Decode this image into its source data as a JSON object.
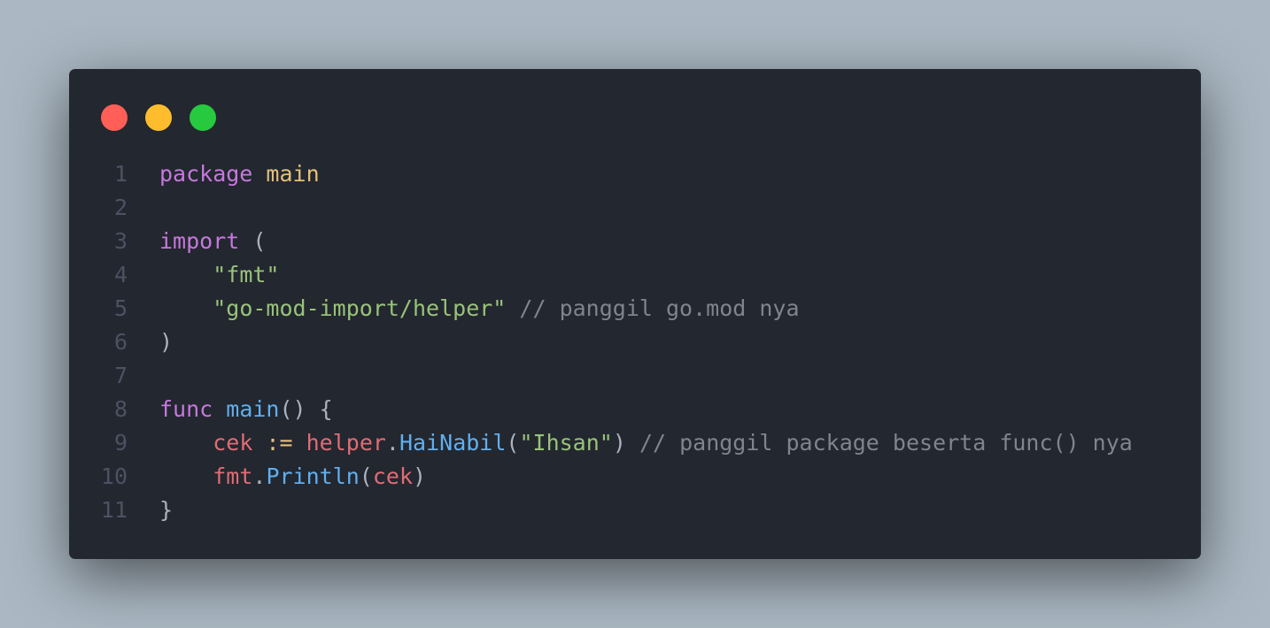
{
  "window": {
    "background": "#23272f",
    "page_background": "#abb8c3",
    "controls": [
      {
        "name": "close-dot",
        "color": "#ff5f56"
      },
      {
        "name": "minimize-dot",
        "color": "#ffbd2e"
      },
      {
        "name": "maximize-dot",
        "color": "#27c93f"
      }
    ]
  },
  "colors": {
    "keyword": "#c678dd",
    "type": "#e5c07b",
    "string": "#98c379",
    "comment": "#7f848e",
    "function": "#61afef",
    "variable": "#e06c75",
    "operator": "#56b6c2",
    "plain": "#abb2bf",
    "line_number": "#4b5263"
  },
  "code": {
    "language": "go",
    "lines": [
      {
        "number": "1",
        "tokens": [
          {
            "text": "package",
            "type": "keyword"
          },
          {
            "text": " ",
            "type": "plain"
          },
          {
            "text": "main",
            "type": "type"
          }
        ]
      },
      {
        "number": "2",
        "tokens": []
      },
      {
        "number": "3",
        "tokens": [
          {
            "text": "import",
            "type": "keyword"
          },
          {
            "text": " (",
            "type": "plain"
          }
        ]
      },
      {
        "number": "4",
        "tokens": [
          {
            "text": "    ",
            "type": "plain"
          },
          {
            "text": "\"fmt\"",
            "type": "string"
          }
        ]
      },
      {
        "number": "5",
        "tokens": [
          {
            "text": "    ",
            "type": "plain"
          },
          {
            "text": "\"go-mod-import/helper\"",
            "type": "string"
          },
          {
            "text": " ",
            "type": "plain"
          },
          {
            "text": "// panggil go.mod nya",
            "type": "comment"
          }
        ]
      },
      {
        "number": "6",
        "tokens": [
          {
            "text": ")",
            "type": "plain"
          }
        ]
      },
      {
        "number": "7",
        "tokens": []
      },
      {
        "number": "8",
        "tokens": [
          {
            "text": "func",
            "type": "keyword"
          },
          {
            "text": " ",
            "type": "plain"
          },
          {
            "text": "main",
            "type": "function"
          },
          {
            "text": "() {",
            "type": "plain"
          }
        ]
      },
      {
        "number": "9",
        "tokens": [
          {
            "text": "    ",
            "type": "plain"
          },
          {
            "text": "cek",
            "type": "variable"
          },
          {
            "text": " ",
            "type": "plain"
          },
          {
            "text": ":=",
            "type": "type"
          },
          {
            "text": " ",
            "type": "plain"
          },
          {
            "text": "helper",
            "type": "variable"
          },
          {
            "text": ".",
            "type": "plain"
          },
          {
            "text": "HaiNabil",
            "type": "function"
          },
          {
            "text": "(",
            "type": "plain"
          },
          {
            "text": "\"Ihsan\"",
            "type": "string"
          },
          {
            "text": ") ",
            "type": "plain"
          },
          {
            "text": "// panggil package beserta func() nya",
            "type": "comment"
          }
        ]
      },
      {
        "number": "10",
        "tokens": [
          {
            "text": "    ",
            "type": "plain"
          },
          {
            "text": "fmt",
            "type": "variable"
          },
          {
            "text": ".",
            "type": "plain"
          },
          {
            "text": "Println",
            "type": "function"
          },
          {
            "text": "(",
            "type": "plain"
          },
          {
            "text": "cek",
            "type": "variable"
          },
          {
            "text": ")",
            "type": "plain"
          }
        ]
      },
      {
        "number": "11",
        "tokens": [
          {
            "text": "}",
            "type": "plain"
          }
        ]
      }
    ]
  }
}
